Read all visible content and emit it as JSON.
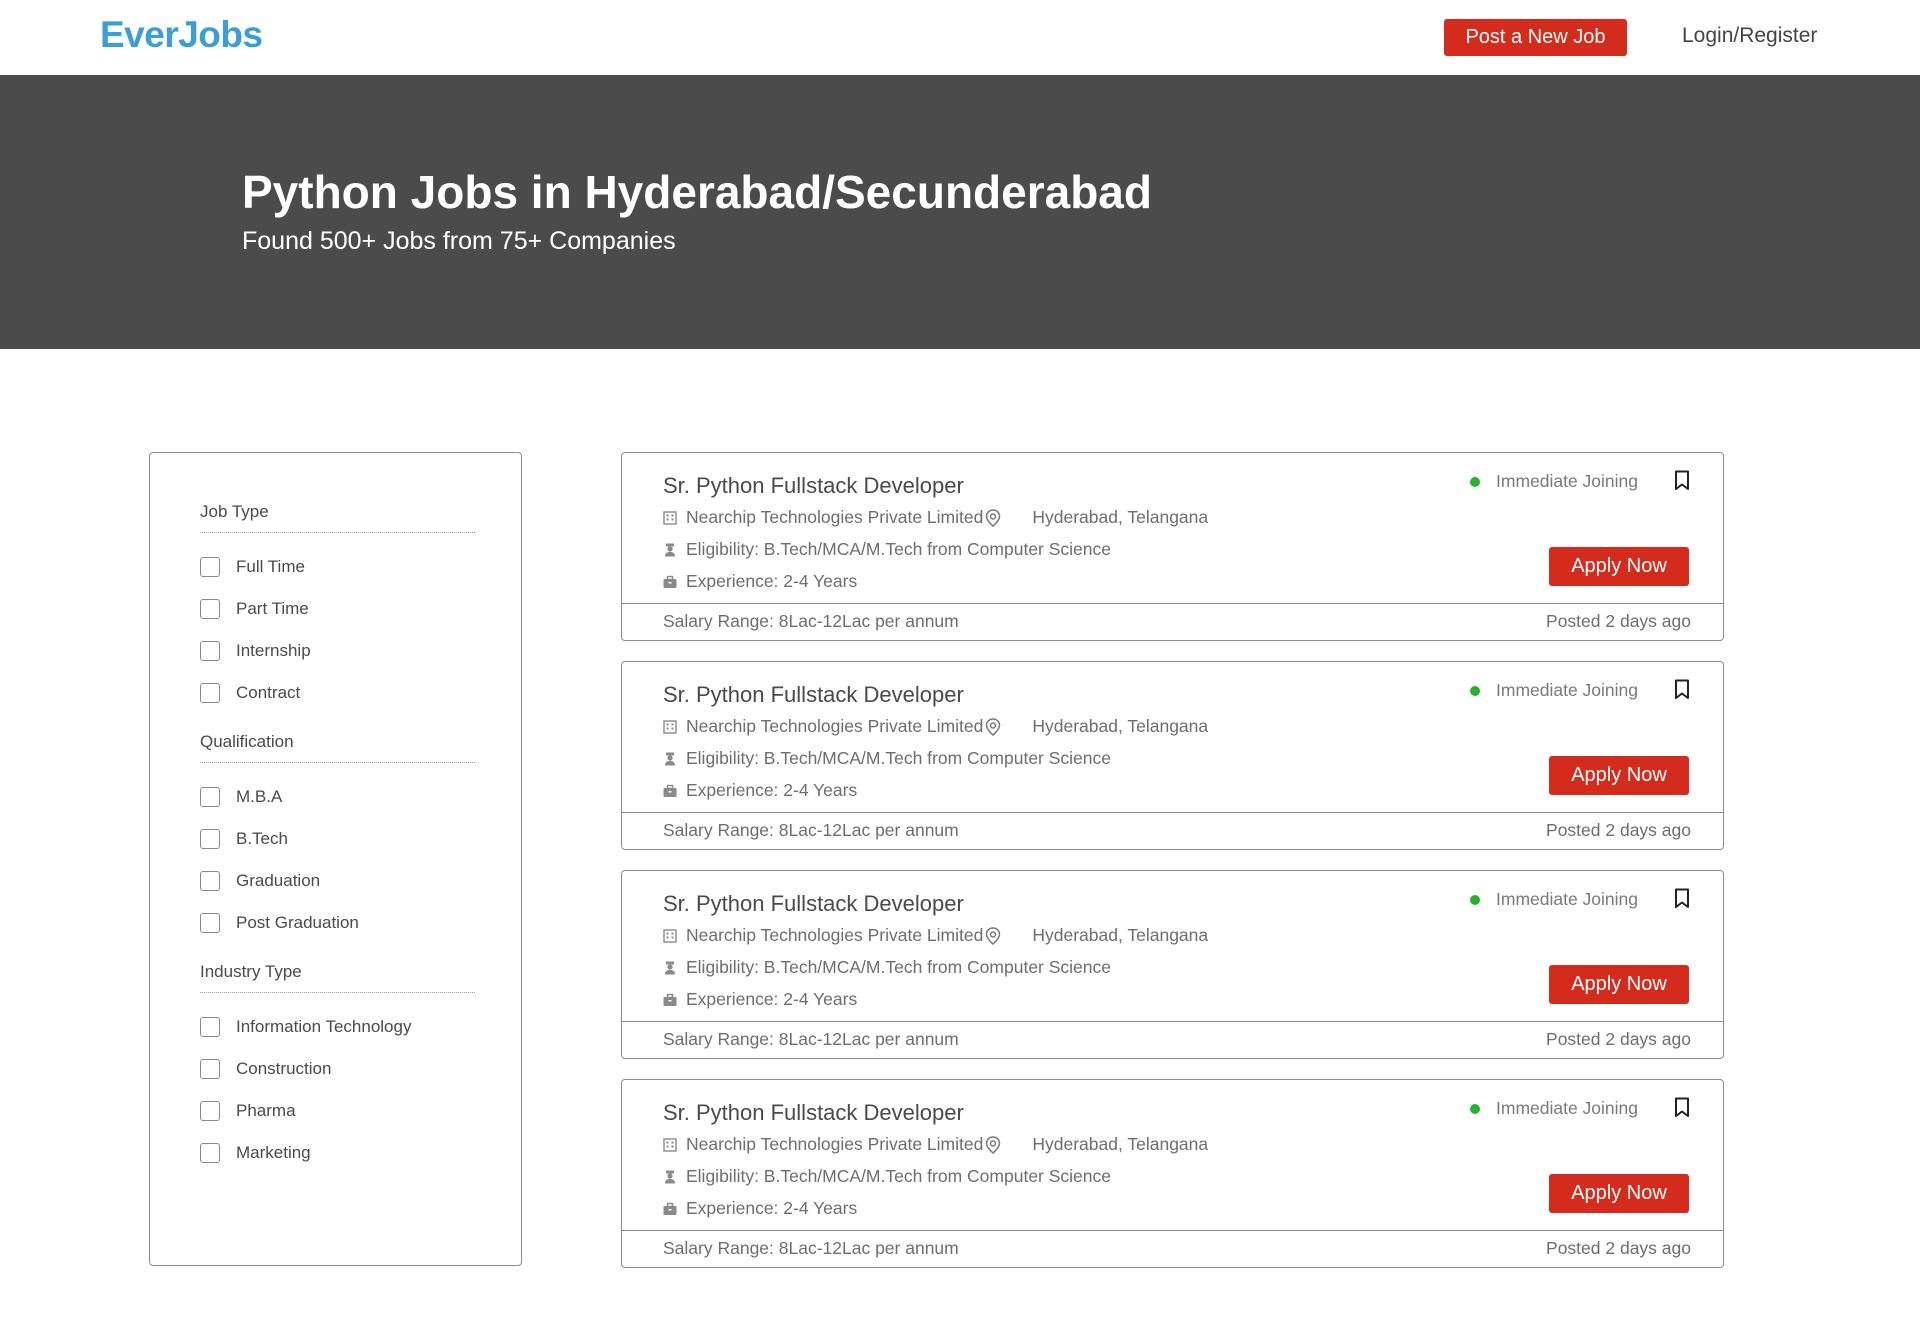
{
  "header": {
    "logo": "EverJobs",
    "post_job_label": "Post a New Job",
    "login_label": "Login/Register"
  },
  "hero": {
    "title": "Python Jobs in Hyderabad/Secunderabad",
    "subtitle": "Found 500+ Jobs from 75+ Companies"
  },
  "filters": {
    "groups": [
      {
        "title": "Job Type",
        "options": [
          "Full Time",
          "Part Time",
          "Internship",
          "Contract"
        ]
      },
      {
        "title": "Qualification",
        "options": [
          "M.B.A",
          "B.Tech",
          "Graduation",
          "Post Graduation"
        ]
      },
      {
        "title": "Industry Type",
        "options": [
          "Information Technology",
          "Construction",
          "Pharma",
          "Marketing"
        ]
      }
    ]
  },
  "jobs": [
    {
      "title": "Sr. Python Fullstack Developer",
      "company": "Nearchip Technologies Private Limited",
      "location": "Hyderabad, Telangana",
      "eligibility": "Eligibility: B.Tech/MCA/M.Tech from Computer Science",
      "experience": "Experience: 2-4 Years",
      "status": "Immediate Joining",
      "apply_label": "Apply Now",
      "salary": "Salary Range: 8Lac-12Lac per annum",
      "posted": "Posted 2 days ago"
    },
    {
      "title": "Sr. Python Fullstack Developer",
      "company": "Nearchip Technologies Private Limited",
      "location": "Hyderabad, Telangana",
      "eligibility": "Eligibility: B.Tech/MCA/M.Tech from Computer Science",
      "experience": "Experience: 2-4 Years",
      "status": "Immediate Joining",
      "apply_label": "Apply Now",
      "salary": "Salary Range: 8Lac-12Lac per annum",
      "posted": "Posted 2 days ago"
    },
    {
      "title": "Sr. Python Fullstack Developer",
      "company": "Nearchip Technologies Private Limited",
      "location": "Hyderabad, Telangana",
      "eligibility": "Eligibility: B.Tech/MCA/M.Tech from Computer Science",
      "experience": "Experience: 2-4 Years",
      "status": "Immediate Joining",
      "apply_label": "Apply Now",
      "salary": "Salary Range: 8Lac-12Lac per annum",
      "posted": "Posted 2 days ago"
    },
    {
      "title": "Sr. Python Fullstack Developer",
      "company": "Nearchip Technologies Private Limited",
      "location": "Hyderabad, Telangana",
      "eligibility": "Eligibility: B.Tech/MCA/M.Tech from Computer Science",
      "experience": "Experience: 2-4 Years",
      "status": "Immediate Joining",
      "apply_label": "Apply Now",
      "salary": "Salary Range: 8Lac-12Lac per annum",
      "posted": "Posted 2 days ago"
    }
  ],
  "colors": {
    "brand": "#3a9fd6",
    "accent": "#d32c1d",
    "hero_bg": "#4b4b4b",
    "status_dot": "#22b42a"
  },
  "icons": [
    "building-icon",
    "location-pin-icon",
    "graduation-icon",
    "briefcase-icon",
    "bookmark-icon",
    "status-dot-icon"
  ]
}
